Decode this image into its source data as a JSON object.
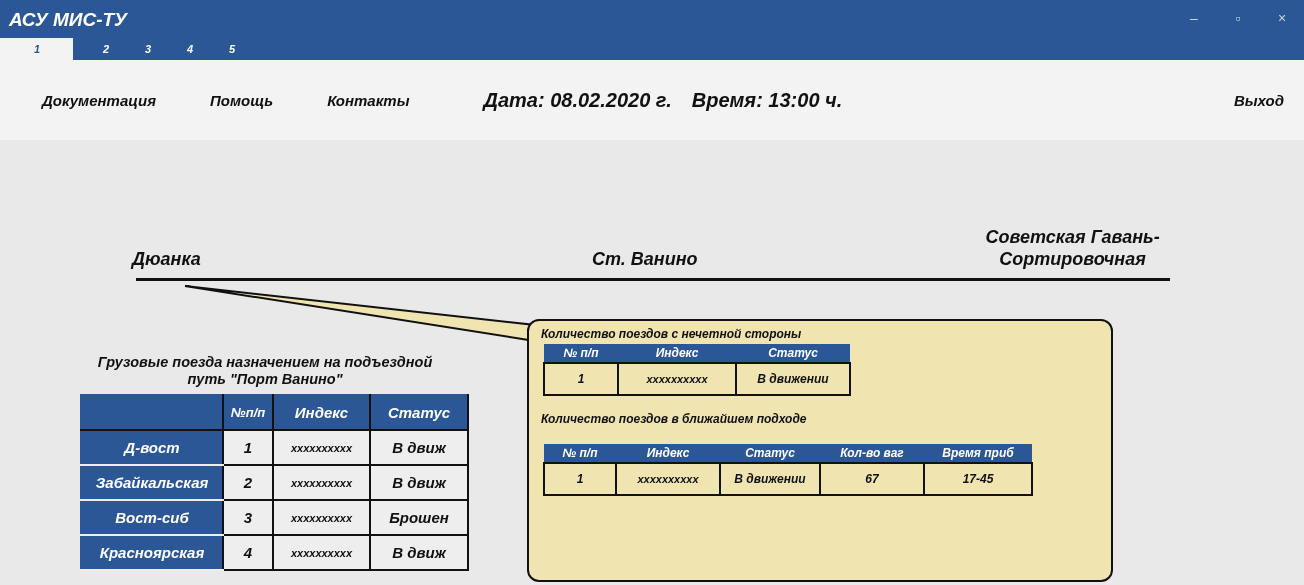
{
  "window": {
    "title": "АСУ МИС-ТУ",
    "controls": [
      "–",
      "▫",
      "×"
    ]
  },
  "tabs": [
    {
      "label": "1",
      "selected": true
    },
    {
      "label": "2",
      "selected": false
    },
    {
      "label": "3",
      "selected": false
    },
    {
      "label": "4",
      "selected": false
    },
    {
      "label": "5",
      "selected": false
    }
  ],
  "menu": [
    "Документация",
    "Помощь",
    "Контакты"
  ],
  "date": "Дата: 08.02.2020 г.",
  "time": "Время: 13:00 ч.",
  "exit": "Выход",
  "stations": {
    "left": "Дюанка",
    "center": "Ст. Ванино",
    "right": "Советская Гавань-\nСортировочная"
  },
  "cargo": {
    "title": "Грузовые поезда назначением на подъездной путь \"Порт Ванино\"",
    "columns": [
      "№п/п",
      "Индекс",
      "Статус"
    ],
    "rows": [
      {
        "name": "Д-вост",
        "cells": [
          "1",
          "xxxxxxxxxx",
          "В движ"
        ]
      },
      {
        "name": "Забайкальская",
        "cells": [
          "2",
          "xxxxxxxxxx",
          "В движ"
        ]
      },
      {
        "name": "Вост-сиб",
        "cells": [
          "3",
          "xxxxxxxxxx",
          "Брошен"
        ]
      },
      {
        "name": "Красноярская",
        "cells": [
          "4",
          "xxxxxxxxxx",
          "В движ"
        ]
      }
    ]
  },
  "callout": {
    "tables": [
      {
        "title": "Количество поездов с нечетной стороны",
        "columns": [
          "№ п/п",
          "Индекс",
          "Статус"
        ],
        "rows": [
          [
            "1",
            "xxxxxxxxxx",
            "В движении"
          ]
        ]
      },
      {
        "title": "Количество поездов в ближайшем подходе",
        "columns": [
          "№ п/п",
          "Индекс",
          "Статус",
          "Кол-во ваг",
          "Время приб"
        ],
        "rows": [
          [
            "1",
            "xxxxxxxxxx",
            "В движении",
            "67",
            "17-45"
          ]
        ]
      }
    ]
  }
}
